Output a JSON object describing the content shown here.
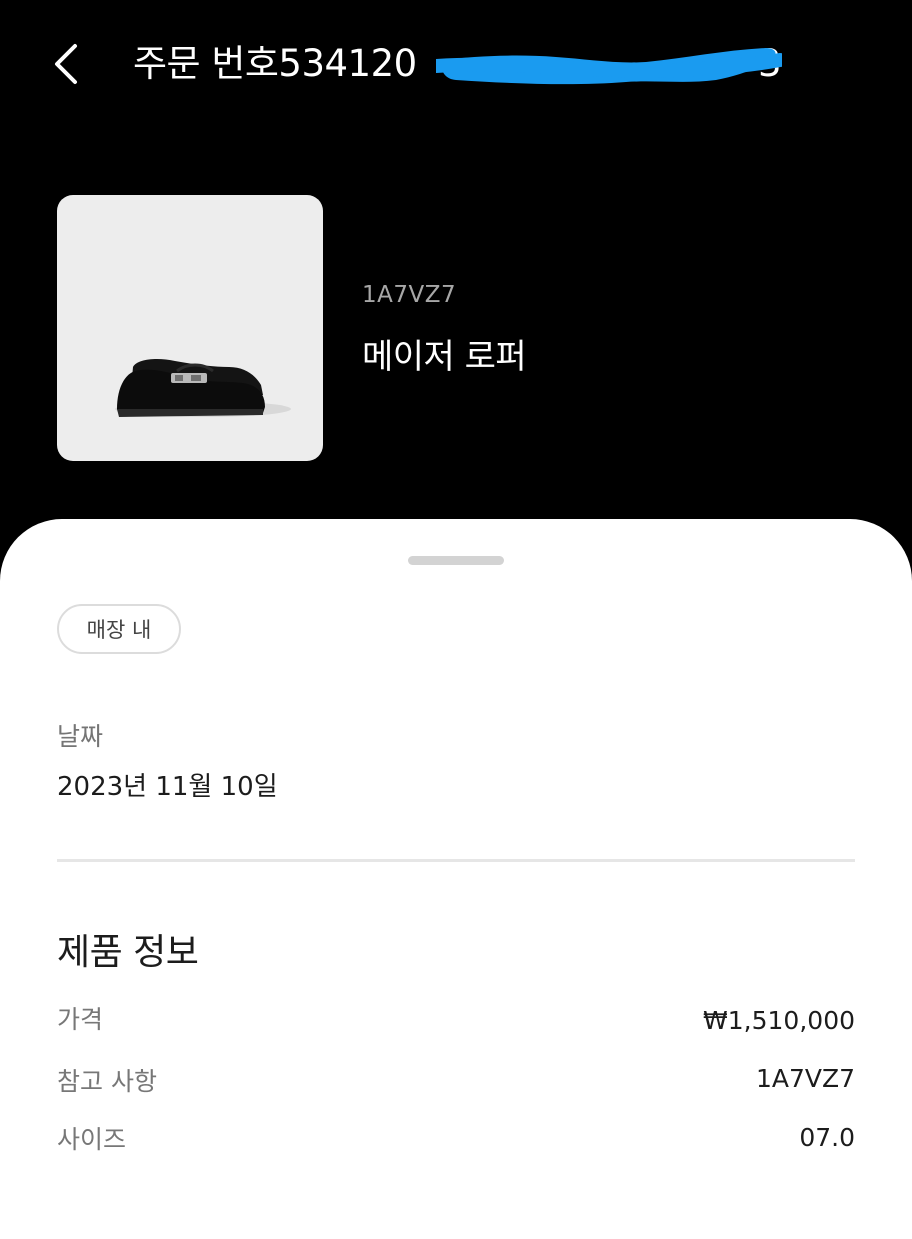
{
  "header": {
    "order_title": "주문 번호534120",
    "order_tail": "3"
  },
  "product": {
    "sku": "1A7VZ7",
    "name": "메이저 로퍼"
  },
  "details": {
    "chip": "매장 내",
    "date_label": "날짜",
    "date_value": "2023년 11월 10일"
  },
  "product_info": {
    "title": "제품 정보",
    "rows": [
      {
        "label": "가격",
        "value": "₩1,510,000"
      },
      {
        "label": "참고 사항",
        "value": "1A7VZ7"
      },
      {
        "label": "사이즈",
        "value": "07.0"
      }
    ]
  },
  "colors": {
    "background": "#000000",
    "sheet": "#ffffff",
    "redaction": "#1a9bf0"
  },
  "icons": {
    "back": "chevron-left-icon"
  }
}
